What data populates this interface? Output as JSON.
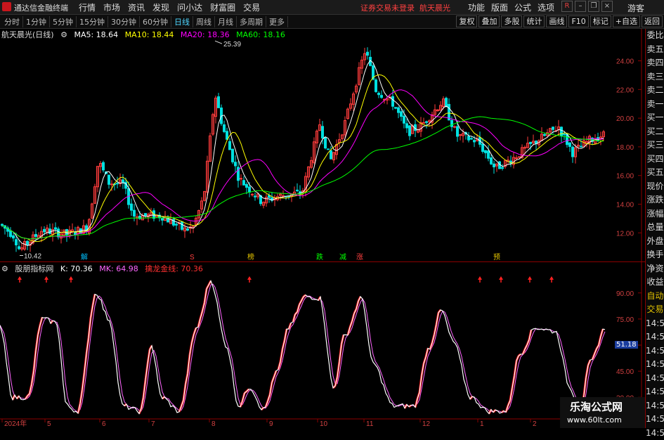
{
  "app": {
    "title": "通达信金融终端",
    "menu": [
      "行情",
      "市场",
      "资讯",
      "发现",
      "问小达",
      "财富圈",
      "交易"
    ],
    "warning": "证券交易未登录",
    "stock_name_top": "航天晨光",
    "right_menu": [
      "功能",
      "版面",
      "公式",
      "选项"
    ],
    "guest_label": "游客"
  },
  "toolbar": {
    "periods": [
      "分时",
      "1分钟",
      "5分钟",
      "15分钟",
      "30分钟",
      "60分钟",
      "日线",
      "周线",
      "月线",
      "多周期",
      "更多"
    ],
    "active_period": "日线",
    "tools": [
      "复权",
      "叠加",
      "多股",
      "统计",
      "画线",
      "F10",
      "标记",
      "+自选",
      "返回"
    ]
  },
  "main_legend": {
    "title": "航天晨光(日线)",
    "ma5": "MA5: 18.64",
    "ma10": "MA10: 18.44",
    "ma20": "MA20: 18.36",
    "ma60": "MA60: 18.16",
    "colors": {
      "ma5": "#ffffff",
      "ma10": "#ffff00",
      "ma20": "#ff00ff",
      "ma60": "#00ff00"
    }
  },
  "price_axis": [
    "24.00",
    "22.00",
    "20.00",
    "18.00",
    "16.00",
    "14.00",
    "12.00"
  ],
  "high_label": "25.39",
  "low_label": "10.42",
  "event_tags": [
    {
      "text": "解",
      "color": "#00c0ff"
    },
    {
      "text": "S",
      "color": "#ff4040"
    },
    {
      "text": "榜",
      "color": "#e0c000"
    },
    {
      "text": "跌",
      "color": "#00ff00"
    },
    {
      "text": "减",
      "color": "#00ff00"
    },
    {
      "text": "涨",
      "color": "#ff4040"
    },
    {
      "text": "预",
      "color": "#e0c000"
    }
  ],
  "indicator_legend": {
    "name": "股朋指标网",
    "k": "K: 70.36",
    "mk": "MK: 64.98",
    "line": "擒龙金线: 70.36"
  },
  "indicator_axis": [
    "90.00",
    "75.00",
    "60.00",
    "45.00",
    "30.00"
  ],
  "indicator_tag": "51.18",
  "date_axis": [
    "2024年",
    "5",
    "6",
    "7",
    "8",
    "9",
    "10",
    "11",
    "12",
    "1",
    "2"
  ],
  "right_panel": [
    "委比",
    "卖五",
    "卖四",
    "卖三",
    "卖二",
    "卖一",
    "买一",
    "买二",
    "买三",
    "买四",
    "买五",
    "现价",
    "涨跌",
    "涨幅",
    "总量",
    "外盘",
    "换手",
    "净资",
    "收益",
    "自动",
    "交易",
    "14:5",
    "14:5",
    "14:5",
    "14:5",
    "14:5",
    "14:5",
    "14:5",
    "14:5",
    "14:5"
  ],
  "watermark": {
    "line1": "乐淘公式网",
    "line2": "www.60lt.com"
  }
}
